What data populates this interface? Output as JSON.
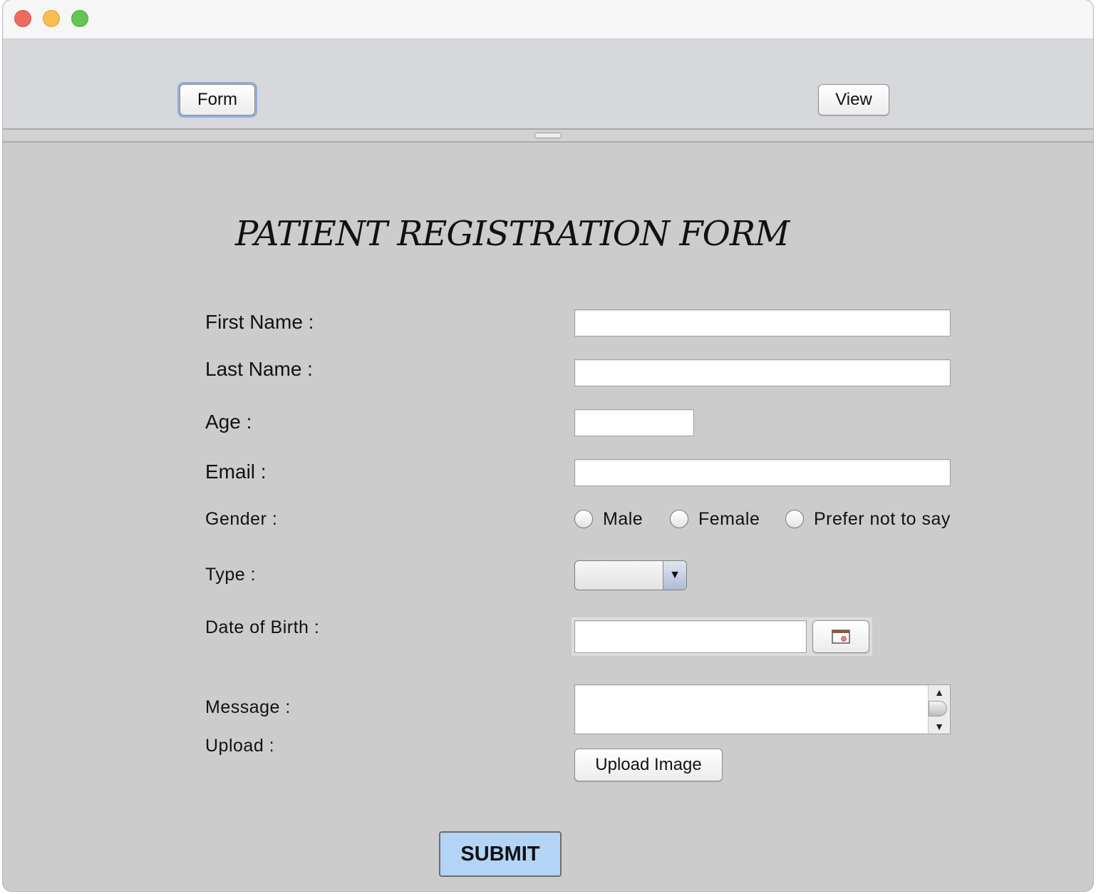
{
  "window": {
    "controls": [
      "close",
      "minimize",
      "maximize"
    ]
  },
  "toolbar": {
    "form_label": "Form",
    "view_label": "View"
  },
  "form": {
    "title": "PATIENT REGISTRATION FORM",
    "labels": {
      "first_name": "First Name :",
      "last_name": "Last Name :",
      "age": "Age :",
      "email": "Email :",
      "gender": "Gender :",
      "type": "Type :",
      "dob": "Date of Birth :",
      "message": "Message :",
      "upload": "Upload :"
    },
    "values": {
      "first_name": "",
      "last_name": "",
      "age": "",
      "email": "",
      "type": "",
      "dob": "",
      "message": ""
    },
    "gender_options": [
      "Male",
      "Female",
      "Prefer not to say"
    ],
    "upload_button": "Upload Image",
    "submit_button": "SUBMIT"
  },
  "icons": {
    "calendar": "calendar-icon",
    "dropdown": "chevron-down-icon"
  },
  "colors": {
    "background": "#cccccc",
    "toolbar": "#d7d8dc",
    "submit": "#b4d4f6",
    "focus_ring": "#93aedb"
  }
}
